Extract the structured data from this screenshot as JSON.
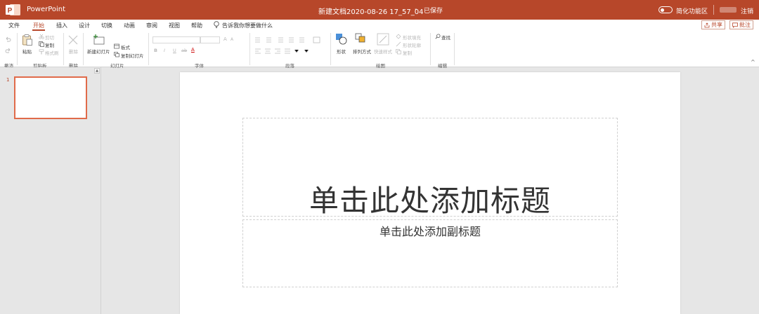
{
  "titlebar": {
    "app_name": "PowerPoint",
    "doc_title": "新建文档2020-08-26 17_57_04",
    "separator": "-",
    "save_status": "已保存",
    "simplified_ribbon": "简化功能区",
    "sign_out": "注销",
    "color": "#b7472a"
  },
  "menu": {
    "tabs": [
      "文件",
      "开始",
      "插入",
      "设计",
      "切换",
      "动画",
      "审阅",
      "视图",
      "帮助"
    ],
    "active_tab": "开始",
    "tell_me": "告诉我你想要做什么",
    "share": "共享",
    "comments": "批注"
  },
  "ribbon": {
    "undo_group": "撤消",
    "clipboard": {
      "paste": "粘贴",
      "cut": "剪切",
      "copy": "复制",
      "format_painter": "格式刷",
      "group": "剪贴板"
    },
    "delete": {
      "label": "删除",
      "group": "删除"
    },
    "slides": {
      "new_slide": "新建幻灯片",
      "layout": "板式",
      "duplicate": "复制幻灯片",
      "group": "幻灯片"
    },
    "font": {
      "bold": "B",
      "italic": "I",
      "underline": "U",
      "strike": "ab",
      "color": "A",
      "grow": "A",
      "shrink": "A",
      "group": "字体"
    },
    "paragraph": {
      "group": "段落"
    },
    "drawing": {
      "shapes": "形状",
      "arrange": "排列方式",
      "quick_styles": "快速样式",
      "fill": "形状填充",
      "outline": "形状轮廓",
      "duplicate": "复制",
      "group": "绘图"
    },
    "editing": {
      "find": "查找",
      "group": "编辑"
    }
  },
  "thumbnails": {
    "slide_number": "1"
  },
  "slide": {
    "title_placeholder": "单击此处添加标题",
    "subtitle_placeholder": "单击此处添加副标题"
  }
}
